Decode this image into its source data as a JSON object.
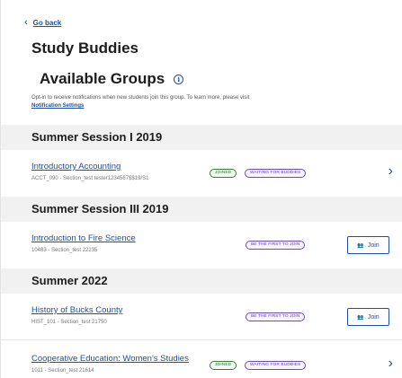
{
  "nav": {
    "back_label": "Go back",
    "back_icon": "chevron-left-icon"
  },
  "page": {
    "title": "Study Buddies"
  },
  "groups": {
    "title": "Available Groups",
    "info_icon": "info-icon",
    "optin_text": "Opt-in to receive notifications when new students join this group. To learn more, please visit",
    "optin_link": "Notification Settings"
  },
  "sessions": [
    {
      "title": "Summer Session I 2019",
      "courses": [
        {
          "name": "Introductory Accounting",
          "meta": "ACCT_090 - Section_test tester1234567$$19/S1",
          "badges": [
            "JOINED",
            "WAITING FOR BUDDIES"
          ],
          "action": "chevron"
        }
      ]
    },
    {
      "title": "Summer Session III 2019",
      "courses": [
        {
          "name": "Introduction to Fire Science",
          "meta": "10483 - Section_test 22235",
          "badges": [
            "BE THE FIRST TO JOIN"
          ],
          "action": "Join"
        }
      ]
    },
    {
      "title": "Summer 2022",
      "courses": [
        {
          "name": "History of Bucks County",
          "meta": "HIST_101 - Section_test 21750",
          "badges": [
            "BE THE FIRST TO JOIN"
          ],
          "action": "Join"
        },
        {
          "name": "Cooperative Education: Women's Studies",
          "meta": "1011 - Section_test 21614",
          "badges": [
            "JOINED",
            "WAITING FOR BUDDIES"
          ],
          "action": "chevron"
        }
      ]
    }
  ],
  "colors": {
    "link": "#1f4fa3",
    "joined": "#2f6a2f",
    "waiting": "#5a3f96",
    "session_bg": "#f1f1f1"
  }
}
